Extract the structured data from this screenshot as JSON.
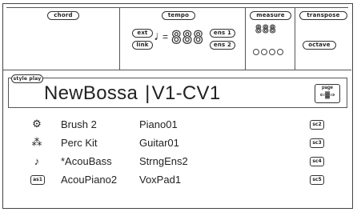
{
  "top": {
    "chord_label": "chord",
    "tempo_label": "tempo",
    "measure_label": "measure",
    "transpose_label": "transpose",
    "octave_label": "octave",
    "ext_label": "ext",
    "link_label": "link",
    "ens1_label": "ens 1",
    "ens2_label": "ens 2",
    "tempo_value": "888",
    "measure_value": "888"
  },
  "style": {
    "play_label": "style play",
    "name": "NewBossa",
    "variation": "V1-CV1",
    "page_label": "page"
  },
  "tracks": [
    {
      "icon": "drum-kit-icon",
      "glyph": "🥁",
      "left": "Brush 2",
      "right": "Piano01",
      "tag": "sc2"
    },
    {
      "icon": "percussion-icon",
      "glyph": "🎲",
      "left": "Perc Kit",
      "right": "Guitar01",
      "tag": "sc3"
    },
    {
      "icon": "bass-guitar-icon",
      "glyph": "🎸",
      "left": "*AcouBass",
      "right": "StrngEns2",
      "tag": "sc4"
    },
    {
      "icon": "keyboard-tag-icon",
      "glyph": "",
      "left": "AcouPiano2",
      "right": "VoxPad1",
      "tag": "sc5"
    }
  ],
  "first_tag": "as1"
}
